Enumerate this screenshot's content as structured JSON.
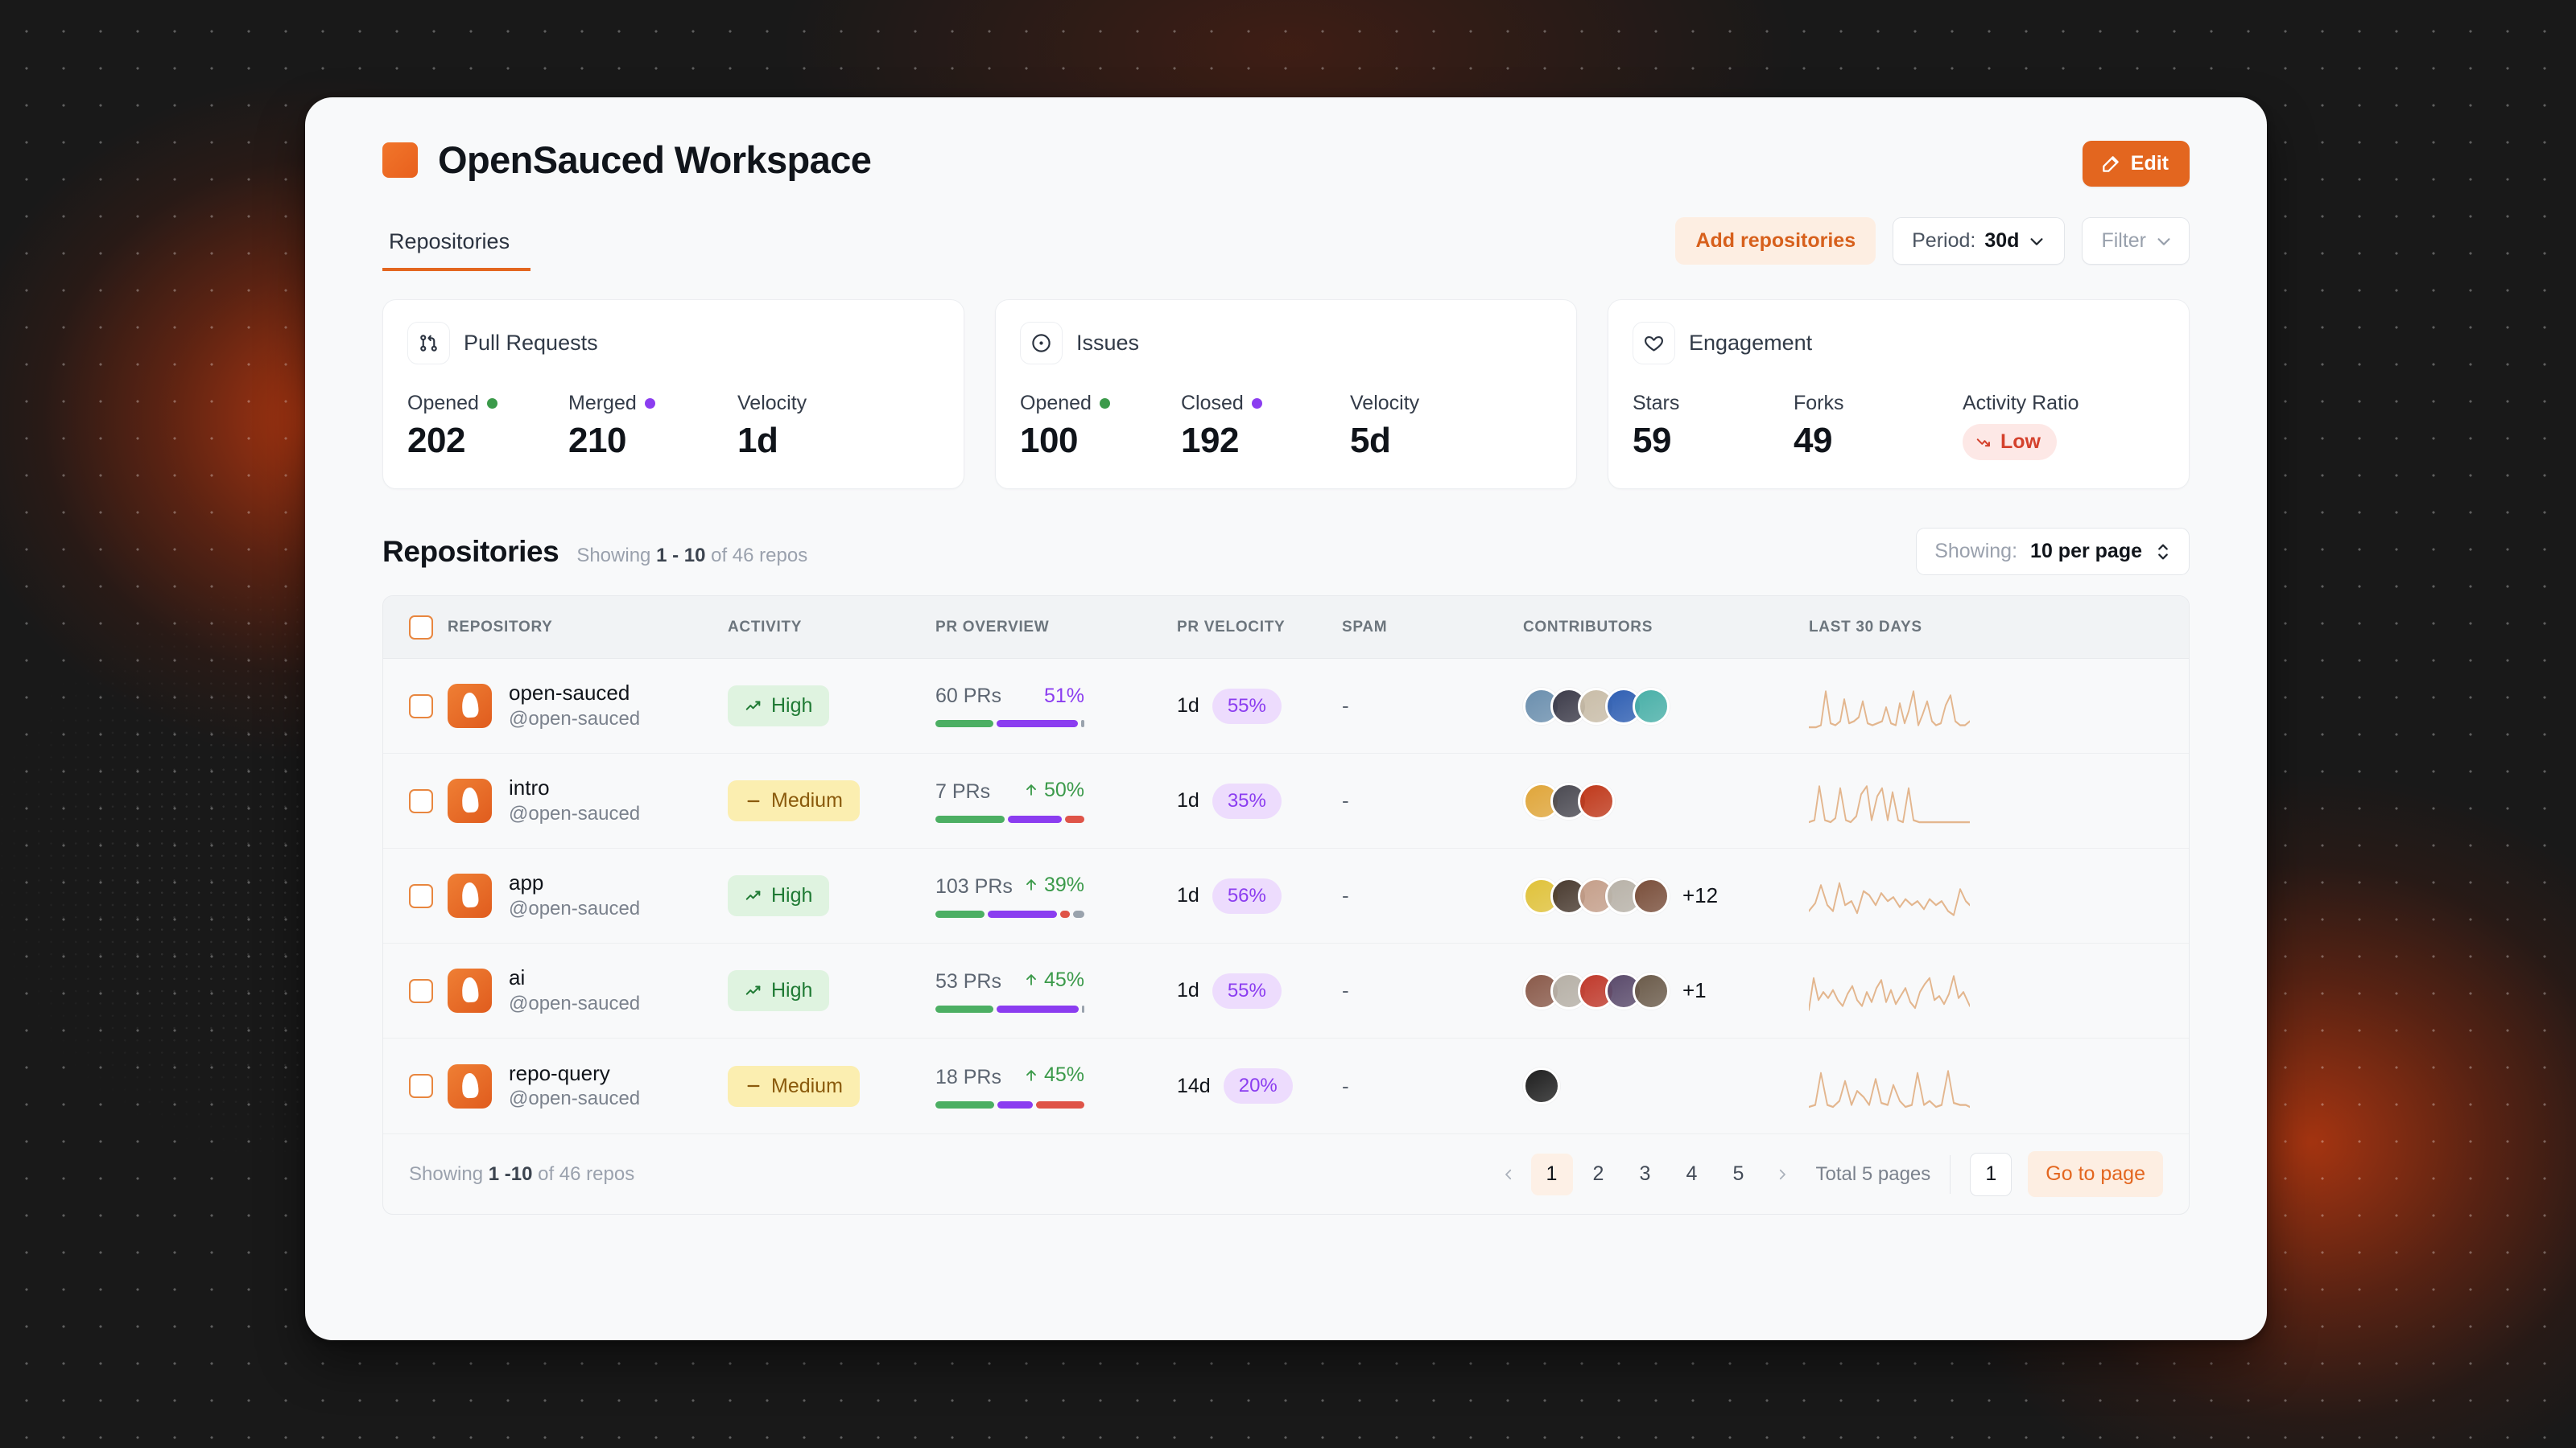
{
  "theme": {
    "accent": "#e3661f",
    "green": "#3b9a4a",
    "purple": "#8b3df0",
    "red": "#d4412c",
    "spark": "#e3b68e"
  },
  "header": {
    "workspace_title": "OpenSauced Workspace",
    "logo_icon": "workspace-square-icon",
    "edit_label": "Edit",
    "edit_icon": "edit-pencil-icon"
  },
  "tabs": [
    {
      "label": "Repositories",
      "active": true
    }
  ],
  "toolbar": {
    "add_repositories_label": "Add repositories",
    "period_prefix": "Period: ",
    "period_value": "30d",
    "filter_label": "Filter"
  },
  "stat_cards": [
    {
      "title": "Pull Requests",
      "icon": "pull-request-icon",
      "metrics": [
        {
          "label": "Opened",
          "dot": "#3b9a4a",
          "value": "202"
        },
        {
          "label": "Merged",
          "dot": "#8b3df0",
          "value": "210"
        },
        {
          "label": "Velocity",
          "dot": null,
          "value": "1d"
        }
      ]
    },
    {
      "title": "Issues",
      "icon": "issue-circle-icon",
      "metrics": [
        {
          "label": "Opened",
          "dot": "#3b9a4a",
          "value": "100"
        },
        {
          "label": "Closed",
          "dot": "#8b3df0",
          "value": "192"
        },
        {
          "label": "Velocity",
          "dot": null,
          "value": "5d"
        }
      ]
    },
    {
      "title": "Engagement",
      "icon": "heart-icon",
      "metrics": [
        {
          "label": "Stars",
          "dot": null,
          "value": "59"
        },
        {
          "label": "Forks",
          "dot": null,
          "value": "49"
        },
        {
          "label": "Activity Ratio",
          "dot": null,
          "value": "Low",
          "badge": "low",
          "badge_icon": "trend-down-icon"
        }
      ]
    }
  ],
  "repositories_section": {
    "heading": "Repositories",
    "showing_prefix": "Showing ",
    "showing_range": "1 - 10",
    "showing_suffix": " of 46 repos",
    "per_page_prefix": "Showing: ",
    "per_page_value": "10 per page"
  },
  "table": {
    "columns": [
      "REPOSITORY",
      "ACTIVITY",
      "PR OVERVIEW",
      "PR VELOCITY",
      "SPAM",
      "CONTRIBUTORS",
      "LAST 30 DAYS"
    ],
    "rows": [
      {
        "name": "open-sauced",
        "owner": "@open-sauced",
        "activity": "High",
        "activity_level": "high",
        "prs": "60 PRs",
        "pct": "51%",
        "pct_dir": "flat",
        "segments": [
          {
            "color": "#4caf63",
            "w": 40
          },
          {
            "color": "#8b3df0",
            "w": 56
          },
          {
            "color": "#9aa3ad",
            "w": 2
          }
        ],
        "velocity": "1d",
        "velocity_pct": "55%",
        "spam": "-",
        "avatars": [
          "#6b8fae",
          "#3d3c4a",
          "#c9bda8",
          "#2f5fb3",
          "#49b0a8"
        ],
        "avatar_more": "",
        "spark": "0,46 9,46 15,44 21,10 27,42 33,44 39,40 44,18 50,42 56,40 62,36 67,20 73,42 79,44 85,42 91,40 96,26 102,42 108,44 113,22 119,42 124,30 130,10 136,44 141,34 147,20 153,40 158,44 164,42 170,24 176,14 182,40 188,44 194,44 200,40"
      },
      {
        "name": "intro",
        "owner": "@open-sauced",
        "activity": "Medium",
        "activity_level": "medium",
        "prs": "7 PRs",
        "pct": "50%",
        "pct_dir": "up",
        "segments": [
          {
            "color": "#4caf63",
            "w": 47
          },
          {
            "color": "#8b3df0",
            "w": 37
          },
          {
            "color": "#df5448",
            "w": 13
          }
        ],
        "velocity": "1d",
        "velocity_pct": "35%",
        "spam": "-",
        "avatars": [
          "#e0a63a",
          "#4b4a52",
          "#c0391b"
        ],
        "avatar_more": "",
        "spark": "0,46 7,44 13,10 20,44 27,46 33,42 39,12 46,44 52,46 59,40 65,18 72,10 78,44 85,20 91,12 98,44 104,16 111,44 117,46 124,12 130,44 137,46 143,46 150,46 156,46 163,46 170,46 176,46 183,46 190,46 196,46 200,46"
      },
      {
        "name": "app",
        "owner": "@open-sauced",
        "activity": "High",
        "activity_level": "high",
        "prs": "103 PRs",
        "pct": "39%",
        "pct_dir": "up",
        "segments": [
          {
            "color": "#4caf63",
            "w": 35
          },
          {
            "color": "#8b3df0",
            "w": 50
          },
          {
            "color": "#df5448",
            "w": 7
          },
          {
            "color": "#9aa3ad",
            "w": 8
          }
        ],
        "velocity": "1d",
        "velocity_pct": "56%",
        "spam": "-",
        "avatars": [
          "#e0c23a",
          "#4a3b30",
          "#c59f8a",
          "#b8b2a8",
          "#7a4f3b"
        ],
        "avatar_more": "+12",
        "spark": "0,40 8,32 15,14 23,34 30,40 38,12 45,34 53,30 60,42 68,20 75,24 83,34 90,22 98,30 105,26 113,36 120,28 128,34 135,30 143,38 150,28 158,34 165,30 173,40 180,44 188,18 195,30 200,34"
      },
      {
        "name": "ai",
        "owner": "@open-sauced",
        "activity": "High",
        "activity_level": "high",
        "prs": "53 PRs",
        "pct": "45%",
        "pct_dir": "up",
        "segments": [
          {
            "color": "#4caf63",
            "w": 40
          },
          {
            "color": "#8b3df0",
            "w": 57
          },
          {
            "color": "#9aa3ad",
            "w": 1.5
          }
        ],
        "velocity": "1d",
        "velocity_pct": "55%",
        "spam": "-",
        "avatars": [
          "#8a5a4a",
          "#b6b0a6",
          "#c0392b",
          "#5a4a6b",
          "#6b5b4a"
        ],
        "avatar_more": "+1",
        "spark": "0,44 6,12 12,34 18,26 24,32 30,24 36,34 42,40 48,28 54,20 60,34 66,40 72,26 78,36 84,22 90,14 96,36 102,24 108,38 114,30 120,22 126,36 132,42 138,26 144,18 150,12 156,34 162,30 168,38 174,28 180,10 186,32 192,26 200,40"
      },
      {
        "name": "repo-query",
        "owner": "@open-sauced",
        "activity": "Medium",
        "activity_level": "medium",
        "prs": "18 PRs",
        "pct": "45%",
        "pct_dir": "up",
        "segments": [
          {
            "color": "#4caf63",
            "w": 40
          },
          {
            "color": "#8b3df0",
            "w": 24
          },
          {
            "color": "#df5448",
            "w": 33
          }
        ],
        "velocity": "14d",
        "velocity_pct": "20%",
        "spam": "-",
        "avatars": [
          "#1f1f1f"
        ],
        "avatar_more": "",
        "spark": "0,46 8,44 15,12 23,44 30,46 38,40 45,20 53,44 60,30 68,36 75,44 83,18 90,42 98,44 105,24 113,40 120,46 128,44 135,12 143,44 150,40 158,46 165,44 173,10 180,42 188,44 195,44 200,46"
      }
    ]
  },
  "footer": {
    "showing_prefix": "Showing ",
    "showing_range": "1 -10",
    "showing_suffix": " of 46 repos",
    "prev_icon": "chevron-left-icon",
    "next_icon": "chevron-right-icon",
    "pages": [
      "1",
      "2",
      "3",
      "4",
      "5"
    ],
    "active_page": "1",
    "total_pages_label": "Total 5 pages",
    "page_input_value": "1",
    "go_to_page_label": "Go to page"
  }
}
